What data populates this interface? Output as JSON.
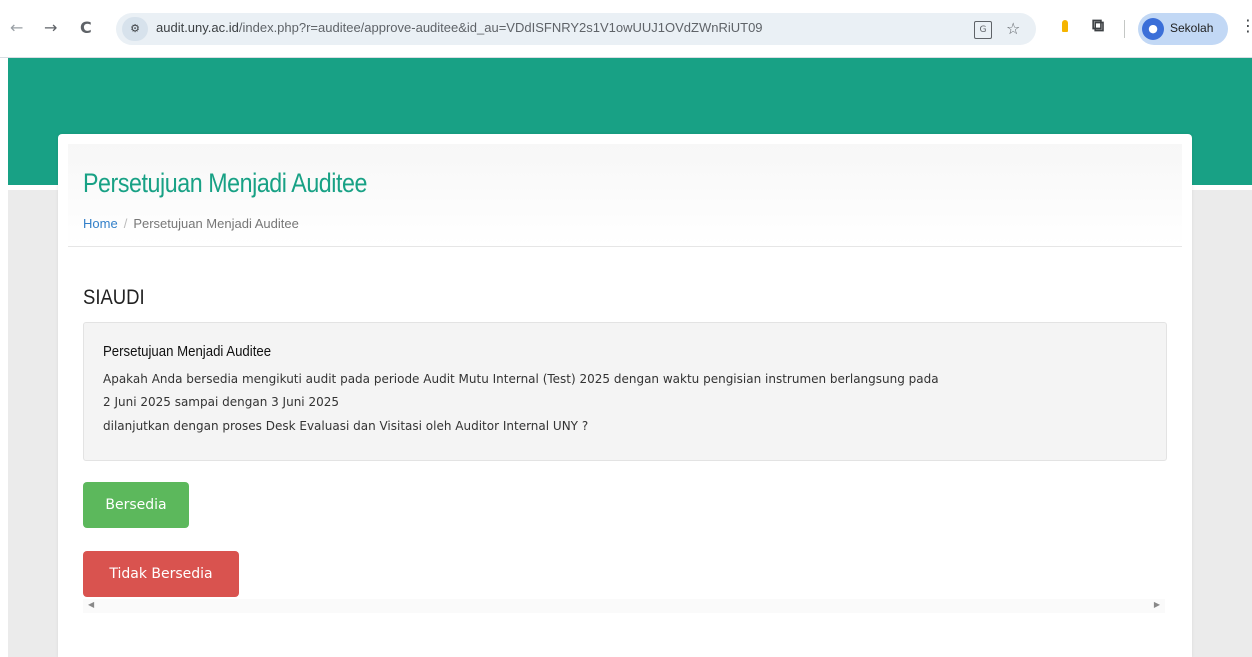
{
  "browser": {
    "back_glyph": "←",
    "forward_glyph": "→",
    "reload_glyph": "C",
    "url_host": "audit.uny.ac.id",
    "url_path": "/index.php?r=auditee/approve-auditee&id_au=VDdISFNRY2s1V1owUUJ1OVdZWnRiUT09",
    "profile_name": "Sekolah",
    "icons": [
      "site-info-icon",
      "translate-icon",
      "star-icon",
      "bulb-icon",
      "puzzle-icon",
      "menu-icon"
    ]
  },
  "page": {
    "title": "Persetujuan Menjadi Auditee",
    "breadcrumb": {
      "home": "Home",
      "separator": "/",
      "current": "Persetujuan Menjadi Auditee"
    },
    "section_title": "SIAUDI",
    "well": {
      "title": "Persetujuan Menjadi Auditee",
      "line1": "Apakah Anda bersedia mengikuti audit pada periode Audit Mutu Internal (Test) 2025 dengan waktu pengisian instrumen berlangsung pada",
      "line2": "2 Juni 2025 sampai dengan 3 Juni 2025",
      "line3": "dilanjutkan dengan proses Desk Evaluasi dan Visitasi oleh Auditor Internal UNY ?"
    },
    "buttons": {
      "accept": "Bersedia",
      "decline": "Tidak Bersedia"
    }
  },
  "colors": {
    "brand_teal": "#18a185",
    "success": "#5cb85c",
    "danger": "#d9534f",
    "link": "#3380c9"
  }
}
